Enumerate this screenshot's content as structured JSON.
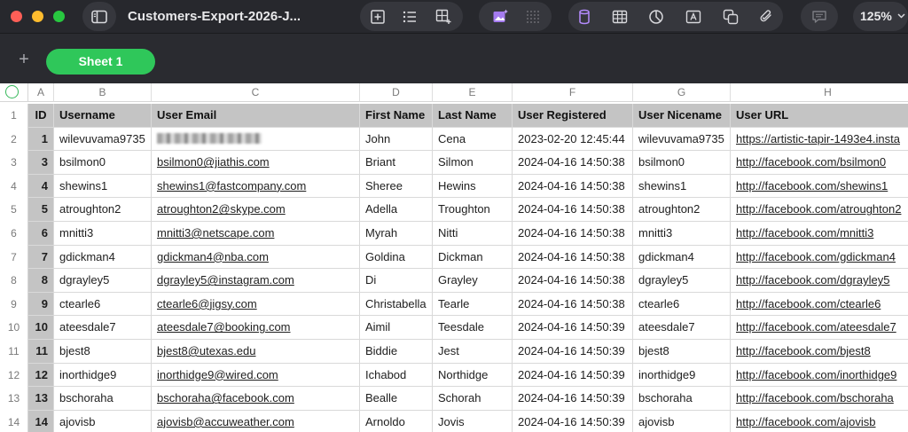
{
  "window": {
    "title": "Customers-Export-2026-J...",
    "zoom": "125%"
  },
  "toolbar_icons": [
    "sidebar-icon",
    "insert-icon",
    "list-icon",
    "table-add-icon",
    "media-icon",
    "grid-dots-icon",
    "cylinder-icon",
    "table-icon",
    "chart-icon",
    "text-box-icon",
    "shapes-icon",
    "attachment-icon",
    "comment-icon"
  ],
  "sheets": [
    {
      "label": "Sheet 1",
      "active": true
    }
  ],
  "colors": {
    "accent": "#2fc75a",
    "toolbar": "#27282d",
    "header_fill": "#c4c4c4"
  },
  "columns": [
    "A",
    "B",
    "C",
    "D",
    "E",
    "F",
    "G",
    "H"
  ],
  "headers": [
    "ID",
    "Username",
    "User Email",
    "First Name",
    "Last Name",
    "User Registered",
    "User Nicename",
    "User URL"
  ],
  "rows": [
    {
      "n": "1",
      "id": "",
      "user": "",
      "email": "",
      "first": "",
      "last": "",
      "reg": "",
      "nice": "",
      "url": ""
    },
    {
      "n": "2",
      "id": "1",
      "user": "wilevuvama9735",
      "email": "",
      "first": "John",
      "last": "Cena",
      "reg": "2023-02-20 12:45:44",
      "nice": "wilevuvama9735",
      "url": "https://artistic-tapir-1493e4.insta"
    },
    {
      "n": "3",
      "id": "3",
      "user": "bsilmon0",
      "email": "bsilmon0@jiathis.com",
      "first": "Briant",
      "last": "Silmon",
      "reg": "2024-04-16 14:50:38",
      "nice": "bsilmon0",
      "url": "http://facebook.com/bsilmon0"
    },
    {
      "n": "4",
      "id": "4",
      "user": "shewins1",
      "email": "shewins1@fastcompany.com",
      "first": "Sheree",
      "last": "Hewins",
      "reg": "2024-04-16 14:50:38",
      "nice": "shewins1",
      "url": "http://facebook.com/shewins1"
    },
    {
      "n": "5",
      "id": "5",
      "user": "atroughton2",
      "email": "atroughton2@skype.com",
      "first": "Adella",
      "last": "Troughton",
      "reg": "2024-04-16 14:50:38",
      "nice": "atroughton2",
      "url": "http://facebook.com/atroughton2"
    },
    {
      "n": "6",
      "id": "6",
      "user": "mnitti3",
      "email": "mnitti3@netscape.com",
      "first": "Myrah",
      "last": "Nitti",
      "reg": "2024-04-16 14:50:38",
      "nice": "mnitti3",
      "url": "http://facebook.com/mnitti3"
    },
    {
      "n": "7",
      "id": "7",
      "user": "gdickman4",
      "email": "gdickman4@nba.com",
      "first": "Goldina",
      "last": "Dickman",
      "reg": "2024-04-16 14:50:38",
      "nice": "gdickman4",
      "url": "http://facebook.com/gdickman4"
    },
    {
      "n": "8",
      "id": "8",
      "user": "dgrayley5",
      "email": "dgrayley5@instagram.com",
      "first": "Di",
      "last": "Grayley",
      "reg": "2024-04-16 14:50:38",
      "nice": "dgrayley5",
      "url": "http://facebook.com/dgrayley5"
    },
    {
      "n": "9",
      "id": "9",
      "user": "ctearle6",
      "email": "ctearle6@jigsy.com",
      "first": "Christabella",
      "last": "Tearle",
      "reg": "2024-04-16 14:50:38",
      "nice": "ctearle6",
      "url": "http://facebook.com/ctearle6"
    },
    {
      "n": "10",
      "id": "10",
      "user": "ateesdale7",
      "email": "ateesdale7@booking.com",
      "first": "Aimil",
      "last": "Teesdale",
      "reg": "2024-04-16 14:50:39",
      "nice": "ateesdale7",
      "url": "http://facebook.com/ateesdale7"
    },
    {
      "n": "11",
      "id": "11",
      "user": "bjest8",
      "email": "bjest8@utexas.edu",
      "first": "Biddie",
      "last": "Jest",
      "reg": "2024-04-16 14:50:39",
      "nice": "bjest8",
      "url": "http://facebook.com/bjest8"
    },
    {
      "n": "12",
      "id": "12",
      "user": "inorthidge9",
      "email": "inorthidge9@wired.com",
      "first": "Ichabod",
      "last": "Northidge",
      "reg": "2024-04-16 14:50:39",
      "nice": "inorthidge9",
      "url": "http://facebook.com/inorthidge9"
    },
    {
      "n": "13",
      "id": "13",
      "user": "bschoraha",
      "email": "bschoraha@facebook.com",
      "first": "Bealle",
      "last": "Schorah",
      "reg": "2024-04-16 14:50:39",
      "nice": "bschoraha",
      "url": "http://facebook.com/bschoraha"
    },
    {
      "n": "14",
      "id": "14",
      "user": "ajovisb",
      "email": "ajovisb@accuweather.com",
      "first": "Arnoldo",
      "last": "Jovis",
      "reg": "2024-04-16 14:50:39",
      "nice": "ajovisb",
      "url": "http://facebook.com/ajovisb"
    }
  ]
}
